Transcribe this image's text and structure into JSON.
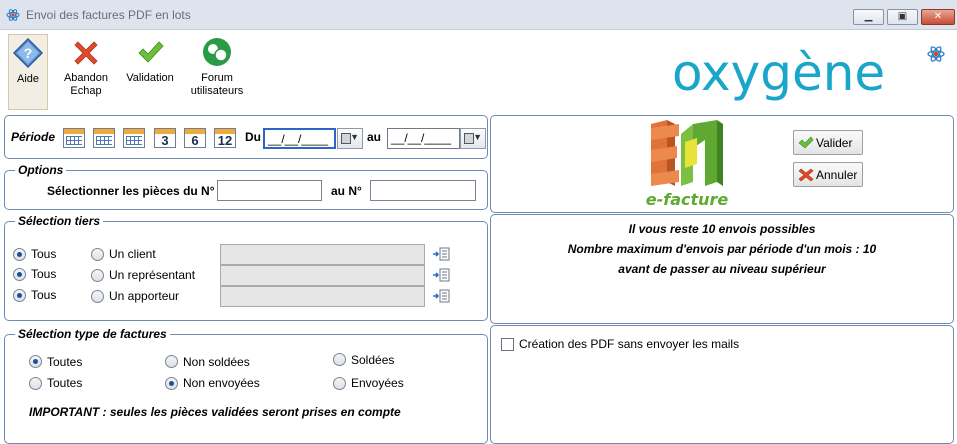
{
  "window": {
    "title": "Envoi des factures PDF en lots"
  },
  "toolbar": {
    "help_label": "Aide",
    "abort_label": "Abandon\nEchap",
    "validate_label": "Validation",
    "forum_label": "Forum\nutilisateurs"
  },
  "brand": {
    "logo_text": "oxygène",
    "logo_color": "#1aa6c9",
    "efacture_text": "e-facture"
  },
  "period": {
    "label": "Période",
    "quick_labels": [
      "3",
      "6",
      "12"
    ],
    "from_label": "Du",
    "to_label": "au",
    "from_value": "__/__/____",
    "to_value": "__/__/____"
  },
  "options": {
    "legend": "Options",
    "from_label": "Sélectionner les pièces du N°",
    "to_label": "au N°",
    "from_value": "",
    "to_value": ""
  },
  "tiers": {
    "legend": "Sélection tiers",
    "rows": [
      {
        "all_label": "Tous",
        "specific_label": "Un client",
        "value": ""
      },
      {
        "all_label": "Tous",
        "specific_label": "Un représentant",
        "value": ""
      },
      {
        "all_label": "Tous",
        "specific_label": "Un apporteur",
        "value": ""
      }
    ]
  },
  "invoice_types": {
    "legend": "Sélection type de factures",
    "row1": [
      "Toutes",
      "Non soldées",
      "Soldées"
    ],
    "row2": [
      "Toutes",
      "Non envoyées",
      "Envoyées"
    ],
    "important": "IMPORTANT : seules les pièces validées seront prises en compte"
  },
  "actions": {
    "validate_label": "Valider",
    "cancel_label": "Annuler"
  },
  "quota": {
    "line1": "Il vous reste 10 envois possibles",
    "line2": "Nombre maximum d'envois par période d'un mois : 10",
    "line3": "avant de passer au niveau supérieur"
  },
  "pdf_only": {
    "label": "Création des PDF sans envoyer les mails",
    "checked": false
  },
  "colors": {
    "frame_border": "#6d8cb5",
    "radio_dot": "#1f4f9a"
  }
}
